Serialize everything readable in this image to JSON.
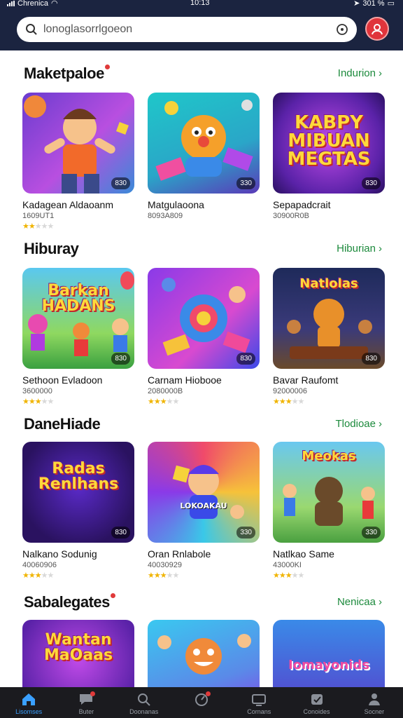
{
  "status_bar": {
    "carrier": "Chrenica",
    "time": "10:13",
    "battery": "301 %"
  },
  "search": {
    "placeholder": "lonoglasorrlgoeon",
    "icon": "search-icon",
    "action_icon": "target-icon"
  },
  "avatar": {
    "icon": "user-badge-icon",
    "color": "#e0343b"
  },
  "sections": [
    {
      "title": "Maketpaloe",
      "has_dot": true,
      "link": "Indurion",
      "cards": [
        {
          "name": "Kadagean Aldaoanm",
          "meta": "1609UT1",
          "badge": "830",
          "rating": 2.5,
          "thumb_text": ""
        },
        {
          "name": "Matgulaoona",
          "meta": "8093A809",
          "badge": "330",
          "rating": 0,
          "thumb_text": ""
        },
        {
          "name": "Sepapadcrait",
          "meta": "30900R0B",
          "badge": "830",
          "rating": 0,
          "thumb_text": "KABPY MIBUAN MEGTAS"
        }
      ]
    },
    {
      "title": "Hiburay",
      "has_dot": false,
      "link": "Hiburian",
      "cards": [
        {
          "name": "Sethoon Evladoon",
          "meta": "3600000",
          "badge": "830",
          "rating": 3,
          "thumb_text": "Barkan HADANS"
        },
        {
          "name": "Carnam Hiobooe",
          "meta": "2080000B",
          "badge": "830",
          "rating": 3,
          "thumb_text": ""
        },
        {
          "name": "Bavar Raufomt",
          "meta": "92000006",
          "badge": "830",
          "rating": 3,
          "thumb_text": "Natlolas"
        }
      ]
    },
    {
      "title": "DaneHiade",
      "has_dot": false,
      "link": "Tlodioae",
      "cards": [
        {
          "name": "Nalkano Sodunig",
          "meta": "40060906",
          "badge": "830",
          "rating": 3,
          "thumb_text": "Radas Renlhans"
        },
        {
          "name": "Oran Rnlabole",
          "meta": "40030929",
          "badge": "330",
          "rating": 3,
          "thumb_text": "LOKOAKAU"
        },
        {
          "name": "Natlkao Same",
          "meta": "43000KI",
          "badge": "330",
          "rating": 3,
          "thumb_text": "Meokas"
        }
      ]
    },
    {
      "title": "Sabalegates",
      "has_dot": true,
      "link": "Nenicaa",
      "cards": [
        {
          "name": "",
          "meta": "",
          "badge": "",
          "rating": 0,
          "thumb_text": "Wantan MaOaas"
        },
        {
          "name": "",
          "meta": "",
          "badge": "",
          "rating": 0,
          "thumb_text": ""
        },
        {
          "name": "",
          "meta": "",
          "badge": "",
          "rating": 0,
          "thumb_text": "Iomayonids"
        }
      ]
    }
  ],
  "tabs": [
    {
      "label": "Lisomses",
      "icon": "home-icon",
      "active": true,
      "dot": false
    },
    {
      "label": "Buter",
      "icon": "chat-icon",
      "active": false,
      "dot": true
    },
    {
      "label": "Doonanas",
      "icon": "search-icon",
      "active": false,
      "dot": false
    },
    {
      "label": "",
      "icon": "gauge-icon",
      "active": false,
      "dot": true
    },
    {
      "label": "Cornans",
      "icon": "tv-icon",
      "active": false,
      "dot": false
    },
    {
      "label": "Conoides",
      "icon": "gamepad-icon",
      "active": false,
      "dot": false
    },
    {
      "label": "Socner",
      "icon": "person-icon",
      "active": false,
      "dot": false
    }
  ],
  "colors": {
    "header": "#1b2440",
    "accent_link": "#1c8a3c",
    "tab_active": "#3aa0ff",
    "notification": "#e03a3a"
  }
}
